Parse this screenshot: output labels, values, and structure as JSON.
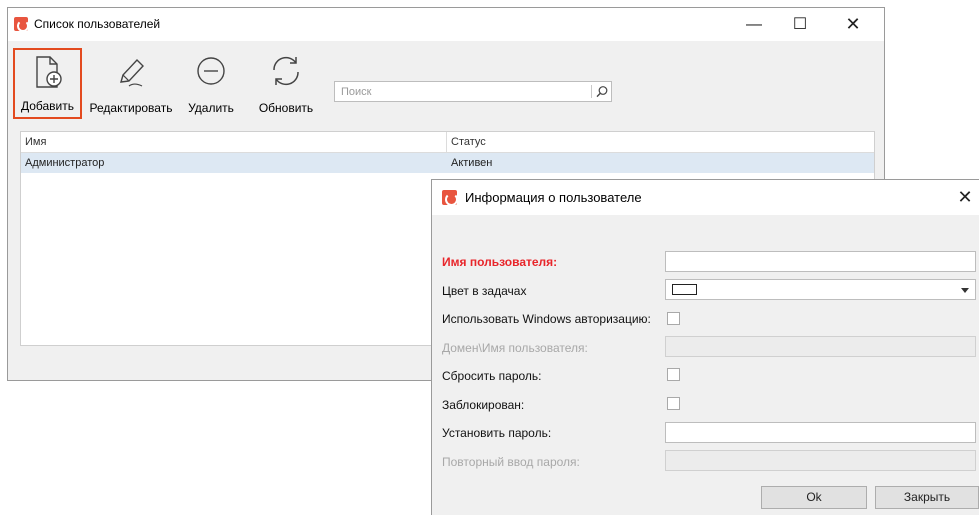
{
  "main_window": {
    "title": "Список пользователей",
    "controls": {
      "minimize": "—",
      "maximize": "☐",
      "close": "✕"
    },
    "toolbar": {
      "add_label": "Добавить",
      "edit_label": "Редактировать",
      "delete_label": "Удалить",
      "refresh_label": "Обновить"
    },
    "search": {
      "placeholder": "Поиск"
    },
    "grid": {
      "columns": [
        "Имя",
        "Статус"
      ],
      "rows": [
        {
          "name": "Администратор",
          "status": "Активен"
        }
      ]
    }
  },
  "dialog": {
    "title": "Информация о пользователе",
    "close": "✕",
    "fields": {
      "username_label": "Имя пользователя:",
      "color_label": "Цвет в задачах",
      "windows_auth_label": "Использовать Windows авторизацию:",
      "domain_label": "Домен\\Имя пользователя:",
      "reset_password_label": "Сбросить пароль:",
      "blocked_label": "Заблокирован:",
      "set_password_label": "Установить пароль:",
      "repeat_password_label": "Повторный ввод пароля:"
    },
    "buttons": {
      "ok": "Ok",
      "close": "Закрыть"
    }
  },
  "colors": {
    "accent_orange": "#e34a1f",
    "required_red": "#e8252a",
    "selected_row": "#dde8f3",
    "logo": "#e8553f"
  }
}
